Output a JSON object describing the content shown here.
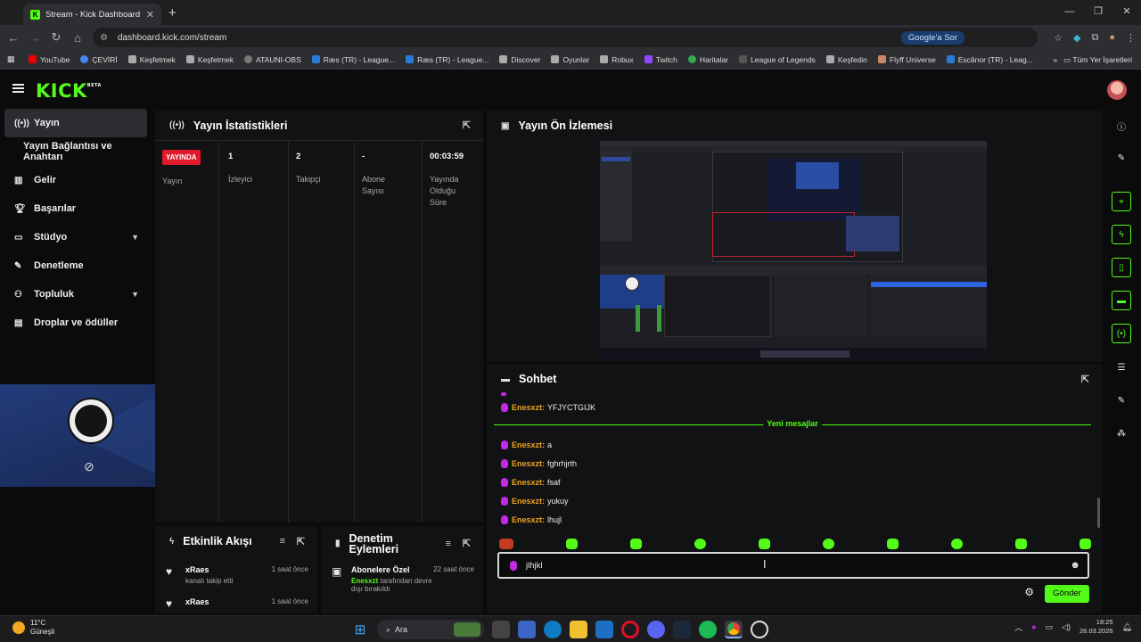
{
  "browser": {
    "tab_title": "Stream - Kick Dashboard",
    "url": "dashboard.kick.com/stream",
    "google_ask": "Google'a Sor",
    "bookmarks": [
      "YouTube",
      "ÇEVİRİ",
      "Keşfetmek",
      "Keşfetmek",
      "ATAUNI-OBS",
      "Ræs (TR) - League...",
      "Ræs (TR) - League...",
      "Discover",
      "Oyunlar",
      "Robux",
      "Twitch",
      "Haritalar",
      "League of Legends",
      "Keşfedin",
      "Flyff Universe",
      "Escânor (TR) - Leag..."
    ],
    "all_bookmarks": "Tüm Yer İşaretleri"
  },
  "kick": {
    "logo": "KICK",
    "logo_badge": "BETA",
    "nav": {
      "yayin": "Yayın",
      "baglanti": "Yayın Bağlantısı ve Anahtarı",
      "gelir": "Gelir",
      "basarilar": "Başarılar",
      "studyo": "Stüdyo",
      "denetleme": "Denetleme",
      "topluluk": "Topluluk",
      "droplar": "Droplar ve ödüller"
    },
    "stats": {
      "title": "Yayın İstatistikleri",
      "live_badge": "YAYINDA",
      "live_label": "Yayın",
      "viewers_value": "1",
      "viewers_label": "İzleyici",
      "followers_value": "2",
      "followers_label": "Takipçi",
      "subs_value": "-",
      "subs_label": "Abone Sayısı",
      "uptime_value": "00:03:59",
      "uptime_label": "Yayında Olduğu Süre"
    },
    "preview": {
      "title": "Yayın Ön İzlemesi"
    },
    "chat": {
      "title": "Sohbet",
      "new_messages": "Yeni mesajlar",
      "top_msg": {
        "user": "Enesxzt:",
        "text": "YFJYCTGIJK"
      },
      "messages": [
        {
          "user": "Enesxzt:",
          "text": "a"
        },
        {
          "user": "Enesxzt:",
          "text": "fghrhjrth"
        },
        {
          "user": "Enesxzt:",
          "text": "fsaf"
        },
        {
          "user": "Enesxzt:",
          "text": "yukuy"
        },
        {
          "user": "Enesxzt:",
          "text": "lhujl"
        }
      ],
      "input_value": "jlhjkl",
      "send_label": "Gönder"
    },
    "events": {
      "title": "Etkinlik Akışı",
      "items": [
        {
          "user": "xRaes",
          "sub": "kanalı takip etti",
          "time": "1 saat önce"
        },
        {
          "user": "xRaes",
          "sub": "",
          "time": "1 saat önce"
        }
      ]
    },
    "moderation": {
      "title": "Denetim Eylemleri",
      "item": {
        "title": "Abonelere Özel",
        "time": "22 saat önce",
        "actor": "Enesxzt",
        "rest": "tarafından devre dışı bırakıldı"
      }
    }
  },
  "taskbar": {
    "temp": "11°C",
    "weather": "Güneşli",
    "search": "Ara",
    "time": "18:25",
    "date": "26.03.2026"
  }
}
